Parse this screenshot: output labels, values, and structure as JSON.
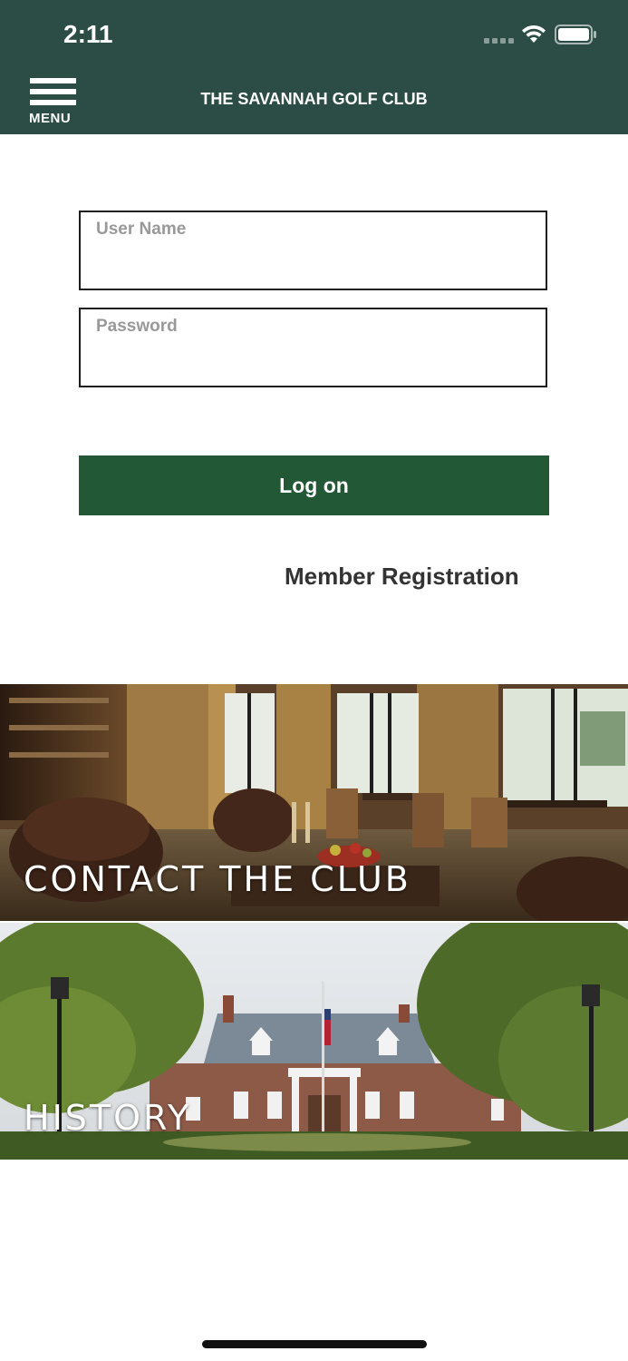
{
  "status_bar": {
    "time": "2:11"
  },
  "header": {
    "menu_label": "MENU",
    "title": "THE SAVANNAH GOLF CLUB",
    "background": "#2c4d46"
  },
  "login": {
    "username_placeholder": "User Name",
    "password_placeholder": "Password",
    "logon_label": "Log on",
    "logon_color": "#235837",
    "register_label": "Member Registration"
  },
  "tiles": [
    {
      "label": "CONTACT THE CLUB",
      "image": "clubhouse-lounge-interior"
    },
    {
      "label": "HISTORY",
      "image": "clubhouse-exterior-with-flag"
    }
  ]
}
